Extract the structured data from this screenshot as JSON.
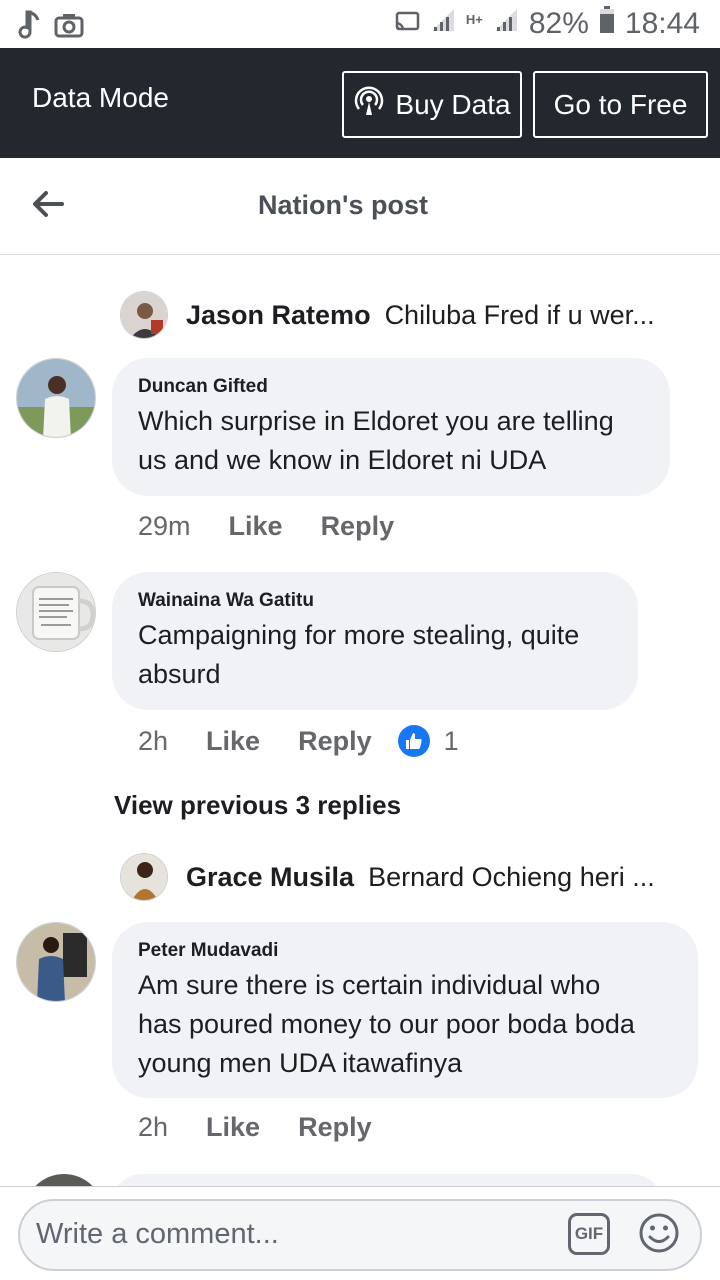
{
  "status_bar": {
    "battery": "82%",
    "time": "18:44",
    "network": "H+"
  },
  "data_bar": {
    "title": "Data Mode",
    "buy_label": "Buy Data",
    "free_label": "Go to Free"
  },
  "header": {
    "title": "Nation's post"
  },
  "replies": [
    {
      "name": "Jason Ratemo",
      "text": "Chiluba Fred if u wer..."
    },
    {
      "name": "Grace Musila",
      "text": "Bernard Ochieng heri ..."
    }
  ],
  "comments": [
    {
      "name": "Duncan Gifted",
      "line1": "Which surprise in Eldoret you are telling",
      "line2": "us and we know in Eldoret ni UDA",
      "time": "29m",
      "like": "Like",
      "reply": "Reply"
    },
    {
      "name": "Wainaina Wa Gatitu",
      "line1": "Campaigning for more stealing, quite",
      "line2": "absurd",
      "time": "2h",
      "like": "Like",
      "reply": "Reply",
      "reactions": "1"
    },
    {
      "name": "Peter Mudavadi",
      "line1": "Am sure there is certain individual who",
      "line2": "has poured money to our poor boda boda",
      "line3": "young men UDA itawafinya",
      "time": "2h",
      "like": "Like",
      "reply": "Reply"
    }
  ],
  "view_previous": "View previous 3 replies",
  "composer": {
    "placeholder": "Write a comment...",
    "gif_label": "GIF"
  },
  "colors": {
    "data_bar_bg": "#23272e",
    "bubble_bg": "#f0f2f5",
    "like_blue": "#1877f2"
  }
}
